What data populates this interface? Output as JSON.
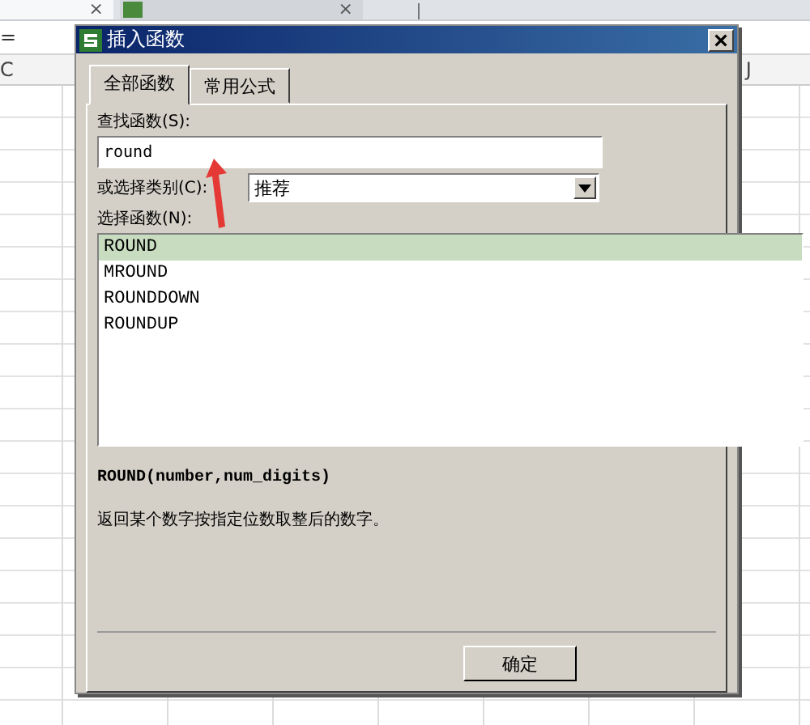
{
  "document_tabs": [
    {
      "close": "×",
      "selected": true
    },
    {
      "close": "×",
      "selected": false
    }
  ],
  "formula_bar": {
    "text": "="
  },
  "column_headers": [
    "C",
    "J"
  ],
  "dialog": {
    "title": "插入函数",
    "tabs": [
      {
        "label": "全部函数",
        "selected": true
      },
      {
        "label": "常用公式",
        "selected": false
      }
    ],
    "search": {
      "label": "查找函数(S):",
      "value": "round"
    },
    "category": {
      "label": "或选择类别(C):",
      "value": "推荐"
    },
    "function_list": {
      "label": "选择函数(N):",
      "items": [
        {
          "name": "ROUND",
          "selected": true
        },
        {
          "name": "MROUND",
          "selected": false
        },
        {
          "name": "ROUNDDOWN",
          "selected": false
        },
        {
          "name": "ROUNDUP",
          "selected": false
        }
      ]
    },
    "signature": "ROUND(number,num_digits)",
    "description": "返回某个数字按指定位数取整后的数字。",
    "buttons": [
      "确定"
    ]
  },
  "annotation": {
    "kind": "arrow"
  }
}
